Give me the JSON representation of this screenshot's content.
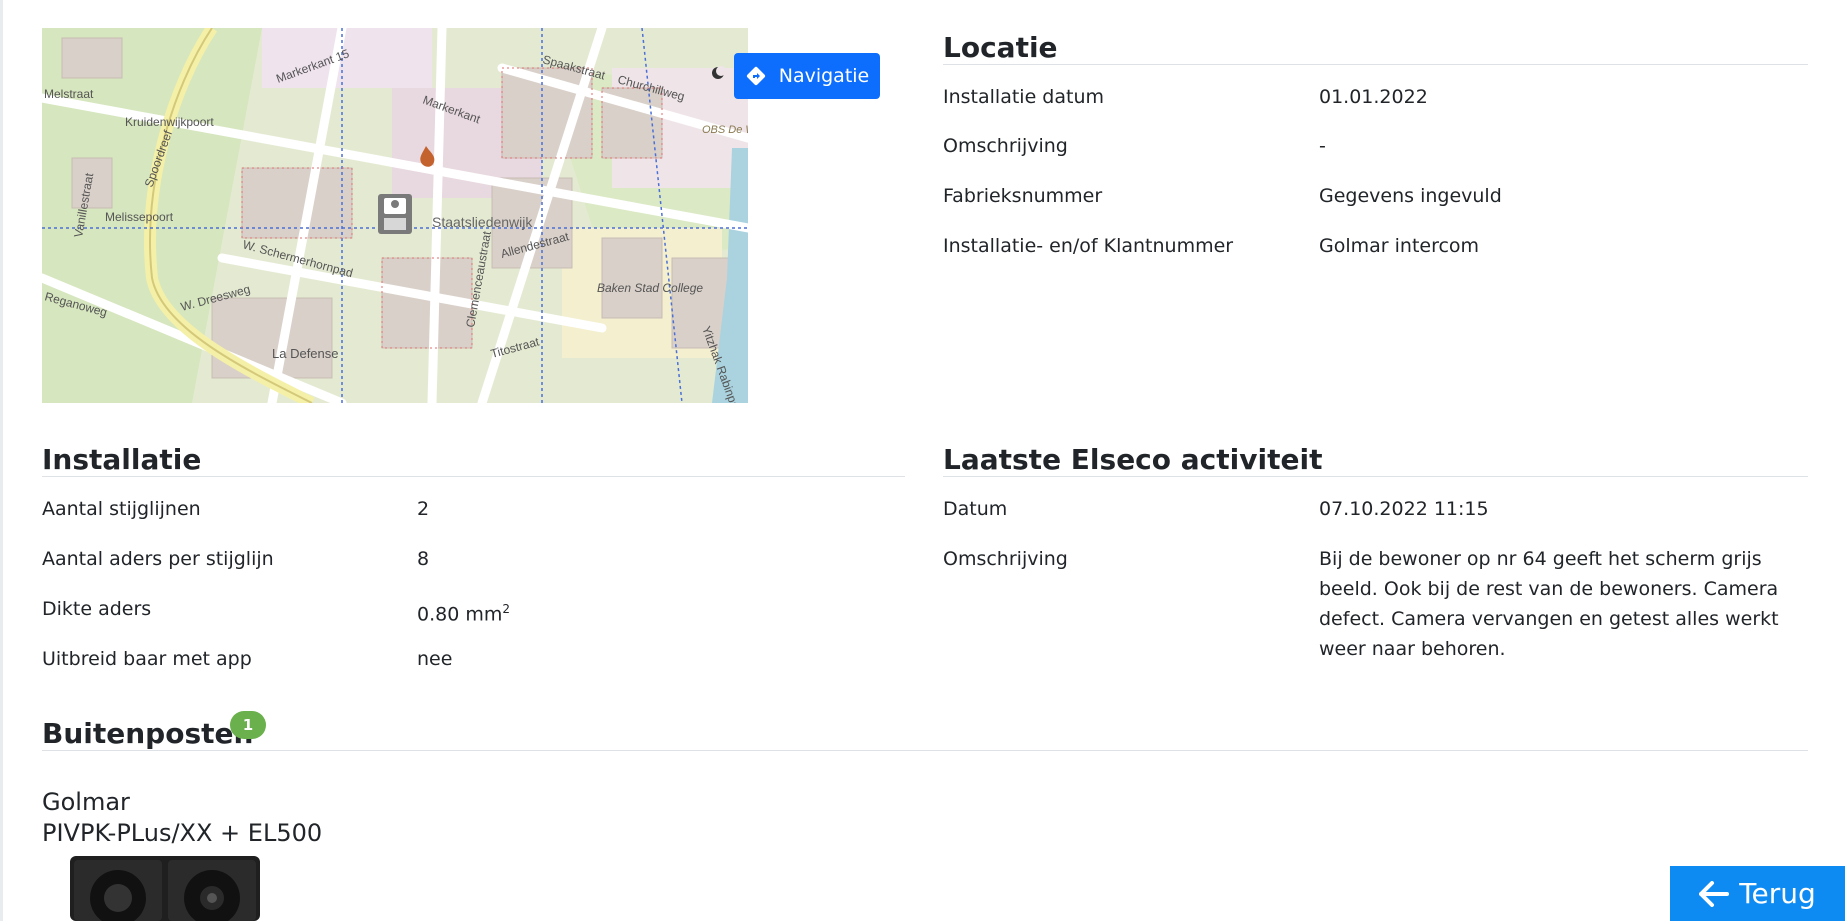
{
  "map": {
    "navigation_label": "Navigatie",
    "street_labels": [
      "Markerkant 15",
      "Markerkant",
      "Spaakstraat",
      "Churchillweg",
      "Kruidenwijkpoort",
      "Spoordreef",
      "Melissepoort",
      "Staatsliedenwijk",
      "W. Schermerhornpad",
      "Allendestraat",
      "W. Dreesweg",
      "La Defense",
      "Baken Stad College",
      "Titostraat",
      "OBS De Watertuin",
      "Clemenceaustraat",
      "Yitzhak Rabinpad",
      "Vanillestraat",
      "Reganoweg",
      "Melstraat"
    ]
  },
  "locatie": {
    "title": "Locatie",
    "rows": [
      {
        "label": "Installatie datum",
        "value": "01.01.2022"
      },
      {
        "label": "Omschrijving",
        "value": "-"
      },
      {
        "label": "Fabrieksnummer",
        "value": "Gegevens ingevuld"
      },
      {
        "label": "Installatie- en/of Klantnummer",
        "value": "Golmar intercom"
      }
    ]
  },
  "installatie": {
    "title": "Installatie",
    "rows": [
      {
        "label": "Aantal stijglijnen",
        "value": "2"
      },
      {
        "label": "Aantal aders per stijglijn",
        "value": "8"
      },
      {
        "label": "Dikte aders",
        "value": "0.80 mm",
        "sup": "2"
      },
      {
        "label": "Uitbreid baar met app",
        "value": "nee"
      }
    ]
  },
  "activiteit": {
    "title": "Laatste Elseco activiteit",
    "rows": [
      {
        "label": "Datum",
        "value": "07.10.2022 11:15"
      },
      {
        "label": "Omschrijving",
        "value": "Bij de bewoner op nr 64 geeft het scherm grijs beeld. Ook bij de rest van de bewoners. Camera defect. Camera vervangen en getest alles werkt weer naar behoren."
      }
    ]
  },
  "buitenposten": {
    "title": "Buitenposten",
    "count": "1",
    "product_brand": "Golmar",
    "product_model": "PIVPK-PLus/XX + EL500"
  },
  "back_button": {
    "label": "Terug"
  },
  "colors": {
    "primary": "#0d6efd",
    "back_button": "#0d8bf2",
    "badge": "#6ab04c",
    "rule": "#dee2e6"
  }
}
